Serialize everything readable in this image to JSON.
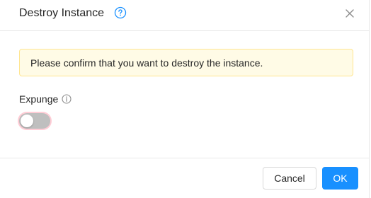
{
  "dialog": {
    "title": "Destroy Instance",
    "help_icon": "question-circle-icon",
    "close_icon": "close-icon"
  },
  "alert": {
    "message": "Please confirm that you want to destroy the instance.",
    "bg_color": "#fffbe6",
    "border_color": "#ffe58f"
  },
  "expunge": {
    "label": "Expunge",
    "info_icon": "info-circle-icon",
    "enabled": false
  },
  "footer": {
    "cancel_label": "Cancel",
    "ok_label": "OK"
  },
  "colors": {
    "accent": "#1890ff",
    "switch_off": "#bfbfbf"
  }
}
